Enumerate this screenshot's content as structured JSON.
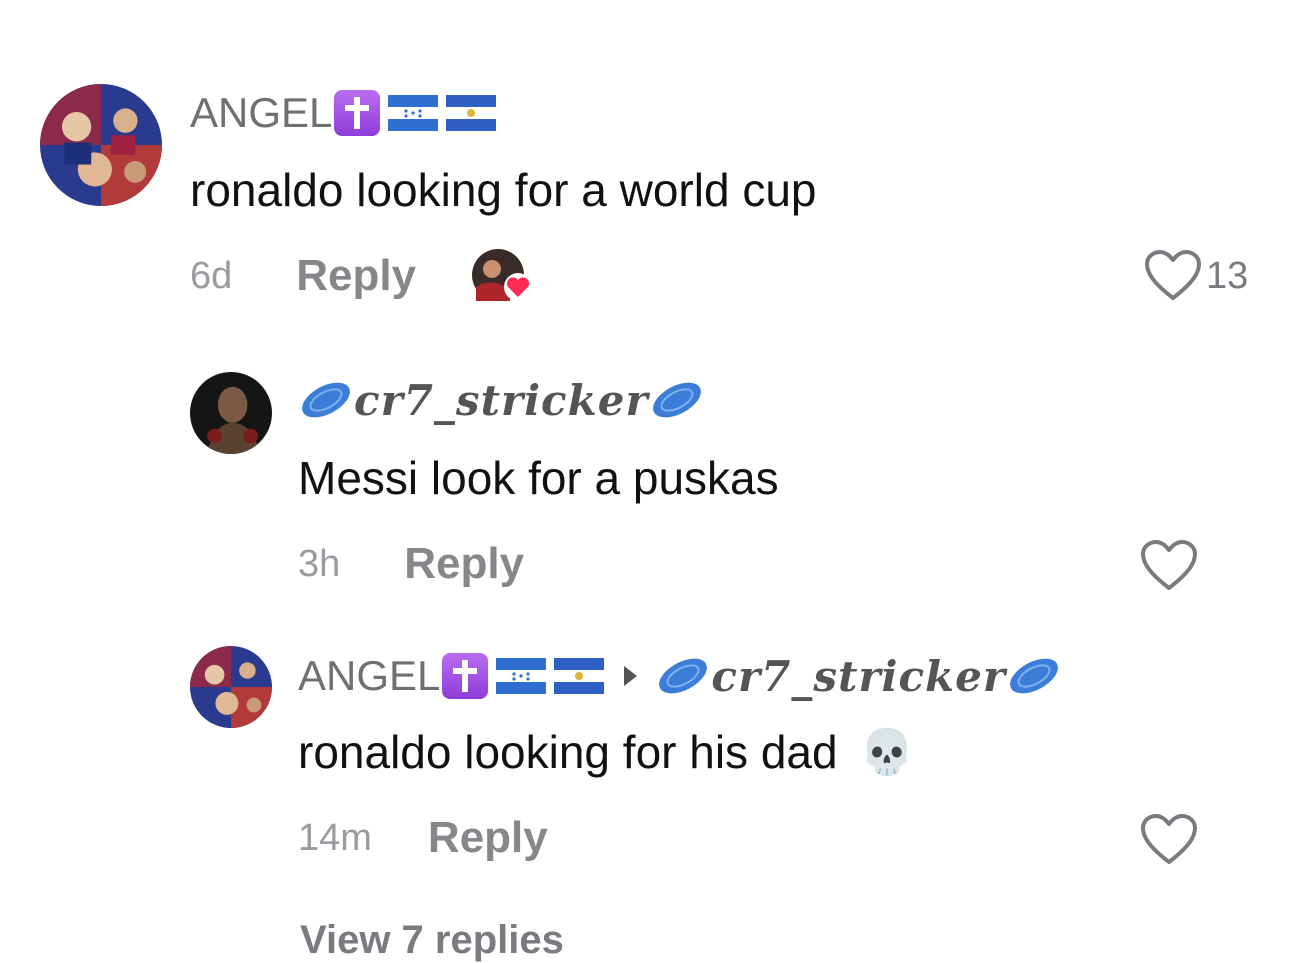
{
  "comments": [
    {
      "username": "ANGEL",
      "text": "ronaldo looking for a world cup",
      "time": "6d",
      "reply_label": "Reply",
      "like_count": "13"
    },
    {
      "username": "cr7_stricker",
      "text": "Messi look for a puskas",
      "time": "3h",
      "reply_label": "Reply",
      "like_count": ""
    },
    {
      "username": "ANGEL",
      "reply_to": "cr7_stricker",
      "text": "ronaldo looking for his dad",
      "emoji": "💀",
      "time": "14m",
      "reply_label": "Reply",
      "like_count": ""
    }
  ],
  "view_more": "View 7 replies",
  "icons": {
    "cross_badge": "cross-badge-icon",
    "flag_honduras": "honduras-flag-icon",
    "flag_el_salvador": "el-salvador-flag-icon",
    "disc": "blue-disc-icon",
    "like": "heart-outline-icon",
    "creator_liked": "creator-heart-badge-icon"
  },
  "colors": {
    "username": "#6f6f74",
    "text": "#111111",
    "meta": "#9a9aa0",
    "reply": "#86868b",
    "badge_purple": "#9b4de0",
    "disc_blue": "#3b7dd8",
    "heart_red": "#fe2c55"
  }
}
